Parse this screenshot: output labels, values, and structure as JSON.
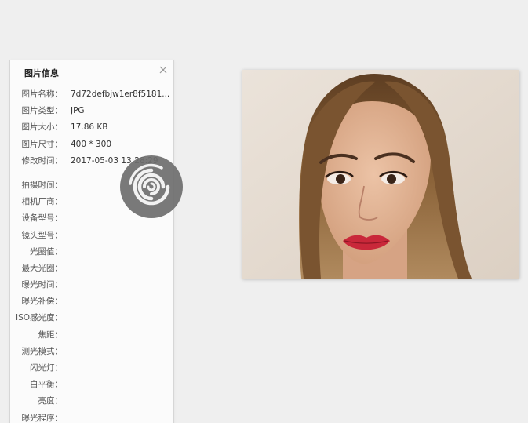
{
  "panel": {
    "title": "图片信息",
    "close_icon": "close-icon",
    "basic_rows": [
      {
        "label": "图片名称：",
        "value": "7d72defbjw1er8f5181..."
      },
      {
        "label": "图片类型：",
        "value": "JPG"
      },
      {
        "label": "图片大小：",
        "value": "17.86 KB"
      },
      {
        "label": "图片尺寸：",
        "value": "400 * 300"
      },
      {
        "label": "修改时间：",
        "value": "2017-05-03 13:28:29"
      }
    ],
    "exif_rows": [
      {
        "label": "拍摄时间："
      },
      {
        "label": "相机厂商："
      },
      {
        "label": "设备型号："
      },
      {
        "label": "镜头型号："
      },
      {
        "label": "光圈值："
      },
      {
        "label": "最大光圈："
      },
      {
        "label": "曝光时间："
      },
      {
        "label": "曝光补偿："
      },
      {
        "label": "ISO感光度："
      },
      {
        "label": "焦距："
      },
      {
        "label": "测光模式："
      },
      {
        "label": "闪光灯："
      },
      {
        "label": "白平衡："
      },
      {
        "label": "亮度："
      },
      {
        "label": "曝光程序："
      }
    ]
  },
  "overlay": {
    "spinner_icon": "loading-swirl-icon"
  },
  "preview": {
    "icon": "portrait-photo"
  },
  "colors": {
    "background": "#efefef",
    "panel_bg": "#fbfbfb",
    "spinner": "#6e6e6e",
    "photo_bg": "#e7ddd2",
    "hair": "#8a6238",
    "skin": "#e2b394",
    "lips": "#c9283a"
  }
}
